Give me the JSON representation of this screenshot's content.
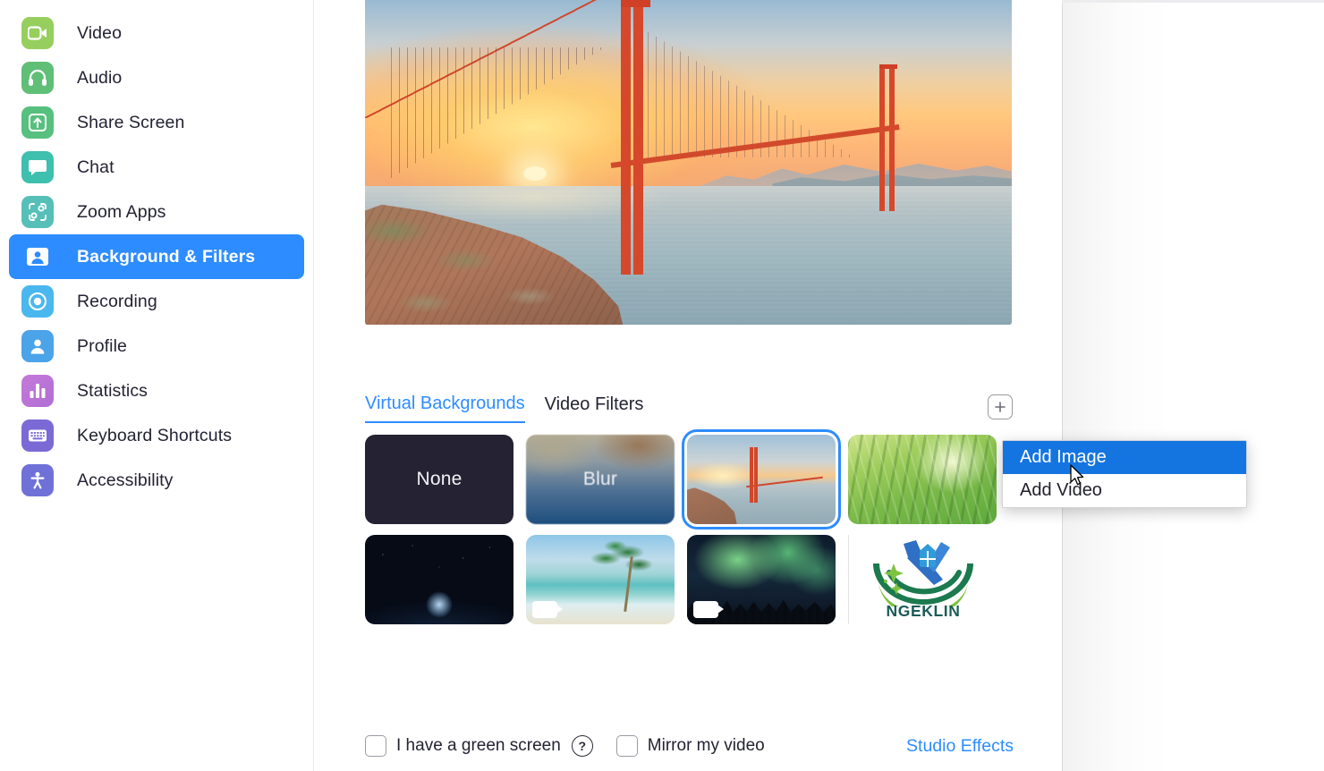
{
  "sidebar": {
    "items": [
      {
        "label": "Video",
        "icon": "video-camera-icon",
        "color": "#96cf5e",
        "active": false
      },
      {
        "label": "Audio",
        "icon": "headphones-icon",
        "color": "#5fbf77",
        "active": false
      },
      {
        "label": "Share Screen",
        "icon": "share-screen-up-arrow-icon",
        "color": "#58c07f",
        "active": false
      },
      {
        "label": "Chat",
        "icon": "chat-bubble-icon",
        "color": "#3fbfae",
        "active": false
      },
      {
        "label": "Zoom Apps",
        "icon": "zoom-apps-icon",
        "color": "#56bfb8",
        "active": false
      },
      {
        "label": "Background & Filters",
        "icon": "person-portrait-icon",
        "color": "#2d8cff",
        "active": true
      },
      {
        "label": "Recording",
        "icon": "record-circle-icon",
        "color": "#4ab8ef",
        "active": false
      },
      {
        "label": "Profile",
        "icon": "person-icon",
        "color": "#4ba3e8",
        "active": false
      },
      {
        "label": "Statistics",
        "icon": "bar-chart-icon",
        "color": "#c479d9",
        "active": false
      },
      {
        "label": "Keyboard Shortcuts",
        "icon": "keyboard-icon",
        "color": "#7b6ad6",
        "active": false
      },
      {
        "label": "Accessibility",
        "icon": "accessibility-person-icon",
        "color": "#6f71d8",
        "active": false
      }
    ]
  },
  "preview": {
    "alt_text": "Golden Gate Bridge at sunset virtual background preview"
  },
  "tabs": [
    {
      "label": "Virtual Backgrounds",
      "active": true
    },
    {
      "label": "Video Filters",
      "active": false
    }
  ],
  "add_button": {
    "glyph": "+",
    "name": "add-background-button"
  },
  "thumbnails": {
    "row1": [
      {
        "label": "None",
        "kind": "none",
        "selected": false,
        "has_video_badge": false
      },
      {
        "label": "Blur",
        "kind": "blur",
        "selected": false,
        "has_video_badge": false
      },
      {
        "label": "",
        "kind": "golden-gate-bridge",
        "selected": true,
        "has_video_badge": false
      },
      {
        "label": "",
        "kind": "grass-dew",
        "selected": false,
        "has_video_badge": false
      }
    ],
    "row2": [
      {
        "label": "",
        "kind": "earth-from-space",
        "selected": false,
        "has_video_badge": false
      },
      {
        "label": "",
        "kind": "tropical-beach",
        "selected": false,
        "has_video_badge": true
      },
      {
        "label": "",
        "kind": "aurora-forest",
        "selected": false,
        "has_video_badge": true
      }
    ],
    "logo_tile": {
      "name": "NGEKLIN",
      "kind": "ngeklin-logo"
    }
  },
  "context_menu": {
    "items": [
      {
        "label": "Add Image",
        "highlighted": true
      },
      {
        "label": "Add Video",
        "highlighted": false
      }
    ]
  },
  "bottom_controls": {
    "green_screen": {
      "label": "I have a green screen",
      "checked": false
    },
    "help_glyph": "?",
    "mirror": {
      "label": "Mirror my video",
      "checked": false
    },
    "studio_effects": {
      "label": "Studio Effects"
    }
  },
  "colors": {
    "accent": "#2d8cff",
    "menu_highlight": "#1575e0",
    "text": "#232333"
  }
}
